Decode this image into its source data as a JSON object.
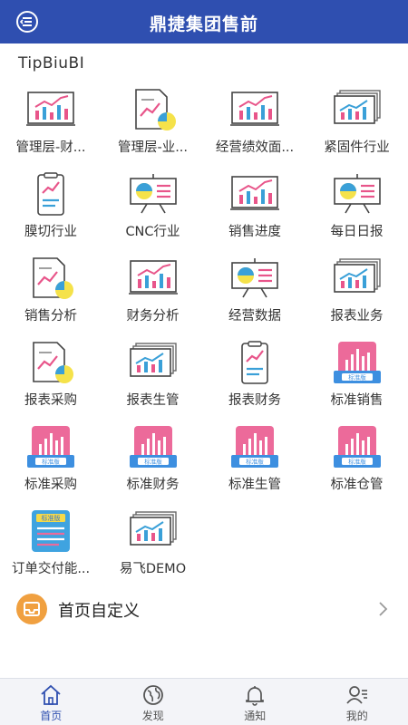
{
  "header": {
    "title": "鼎捷集团售前",
    "menu_icon": "menu-icon"
  },
  "section": {
    "title": "TipBiuBI"
  },
  "apps": [
    {
      "label": "管理层-财...",
      "icon": "chart-board-icon"
    },
    {
      "label": "管理层-业...",
      "icon": "report-pie-icon"
    },
    {
      "label": "经营绩效面...",
      "icon": "chart-board-icon"
    },
    {
      "label": "紧固件行业",
      "icon": "chart-stack-icon"
    },
    {
      "label": "膜切行业",
      "icon": "clipboard-chart-icon"
    },
    {
      "label": "CNC行业",
      "icon": "presentation-icon"
    },
    {
      "label": "销售进度",
      "icon": "chart-board-icon"
    },
    {
      "label": "每日日报",
      "icon": "presentation-icon"
    },
    {
      "label": "销售分析",
      "icon": "report-pie-icon"
    },
    {
      "label": "财务分析",
      "icon": "chart-board-icon"
    },
    {
      "label": "经营数据",
      "icon": "presentation-icon"
    },
    {
      "label": "报表业务",
      "icon": "chart-stack-icon"
    },
    {
      "label": "报表采购",
      "icon": "report-pie-icon"
    },
    {
      "label": "报表生管",
      "icon": "chart-stack-icon"
    },
    {
      "label": "报表财务",
      "icon": "clipboard-chart-icon"
    },
    {
      "label": "标准销售",
      "icon": "standard-edition-icon"
    },
    {
      "label": "标准采购",
      "icon": "standard-edition-icon"
    },
    {
      "label": "标准财务",
      "icon": "standard-edition-icon"
    },
    {
      "label": "标准生管",
      "icon": "standard-edition-icon"
    },
    {
      "label": "标准仓管",
      "icon": "standard-edition-icon"
    },
    {
      "label": "订单交付能...",
      "icon": "standard-list-icon"
    },
    {
      "label": "易飞DEMO",
      "icon": "chart-stack-icon"
    }
  ],
  "badge_text": "标准版",
  "custom": {
    "label": "首页自定义",
    "icon": "inbox-icon"
  },
  "tabs": [
    {
      "label": "首页",
      "icon": "home-icon",
      "active": true
    },
    {
      "label": "发现",
      "icon": "globe-icon",
      "active": false
    },
    {
      "label": "通知",
      "icon": "bell-icon",
      "active": false
    },
    {
      "label": "我的",
      "icon": "profile-icon",
      "active": false
    }
  ],
  "colors": {
    "brand": "#2f4fb0",
    "accent_pink": "#e8558a",
    "accent_blue": "#3aa0d8",
    "accent_yellow": "#f5e24a",
    "custom_orange": "#f0a040"
  }
}
